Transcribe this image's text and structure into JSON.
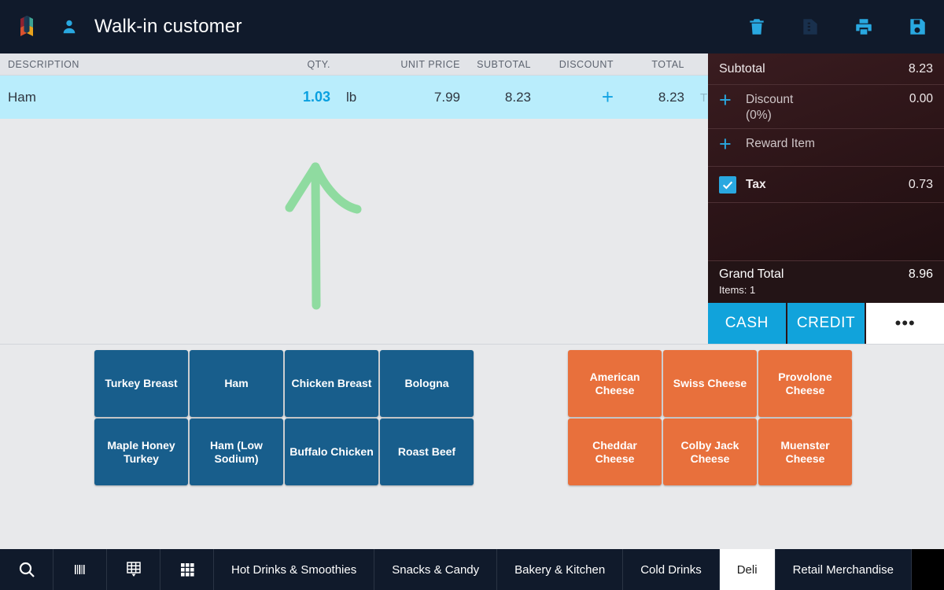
{
  "header": {
    "logo_icon": "leaf-logo-icon",
    "person_icon": "person-icon",
    "customer_name": "Walk-in customer",
    "actions": [
      {
        "name": "delete-order-button",
        "icon": "trash-icon",
        "enabled": true
      },
      {
        "name": "order-note-button",
        "icon": "note-icon",
        "enabled": false
      },
      {
        "name": "print-order-button",
        "icon": "printer-icon",
        "enabled": true
      },
      {
        "name": "save-order-button",
        "icon": "save-icon",
        "enabled": true
      }
    ]
  },
  "order_table": {
    "columns": {
      "description": "DESCRIPTION",
      "qty": "QTY.",
      "unit_price": "UNIT PRICE",
      "subtotal": "SUBTOTAL",
      "discount": "DISCOUNT",
      "total": "TOTAL"
    },
    "rows": [
      {
        "description": "Ham",
        "qty": "1.03",
        "unit": "lb",
        "unit_price": "7.99",
        "subtotal": "8.23",
        "discount_icon": "plus-icon",
        "total": "8.23",
        "tax_flag": "T",
        "selected": true
      }
    ]
  },
  "annotation": {
    "type": "hand-drawn-arrow",
    "points_to": "qty-value",
    "color": "#8fdba0"
  },
  "summary": {
    "subtotal_label": "Subtotal",
    "subtotal_value": "8.23",
    "discount_label": "Discount",
    "discount_percent": "(0%)",
    "discount_value": "0.00",
    "discount_add_icon": "plus-icon",
    "reward_label": "Reward Item",
    "reward_add_icon": "plus-icon",
    "tax_label": "Tax",
    "tax_value": "0.73",
    "tax_checked": true,
    "grand_total_label": "Grand Total",
    "grand_total_value": "8.96",
    "items_label": "Items: 1",
    "cash_label": "CASH",
    "credit_label": "CREDIT",
    "more_label": "•••"
  },
  "products": {
    "meats": [
      {
        "label": "Turkey Breast"
      },
      {
        "label": "Ham"
      },
      {
        "label": "Chicken Breast"
      },
      {
        "label": "Bologna"
      },
      {
        "label": "Maple Honey Turkey"
      },
      {
        "label": "Ham (Low Sodium)"
      },
      {
        "label": "Buffalo Chicken"
      },
      {
        "label": "Roast Beef"
      }
    ],
    "cheeses": [
      {
        "label": "American Cheese"
      },
      {
        "label": "Swiss Cheese"
      },
      {
        "label": "Provolone Cheese"
      },
      {
        "label": "Cheddar Cheese"
      },
      {
        "label": "Colby Jack Cheese"
      },
      {
        "label": "Muenster Cheese"
      }
    ],
    "meat_color": "#185e8c",
    "cheese_color": "#e8703c"
  },
  "bottom_bar": {
    "icons": [
      {
        "name": "search-icon"
      },
      {
        "name": "barcode-icon"
      },
      {
        "name": "grid-dropdown-icon"
      },
      {
        "name": "apps-grid-icon"
      }
    ],
    "tabs": [
      {
        "label": "Hot Drinks & Smoothies",
        "active": false
      },
      {
        "label": "Snacks & Candy",
        "active": false
      },
      {
        "label": "Bakery & Kitchen",
        "active": false
      },
      {
        "label": "Cold Drinks",
        "active": false
      },
      {
        "label": "Deli",
        "active": true
      },
      {
        "label": "Retail Merchandise",
        "active": false
      }
    ]
  },
  "colors": {
    "header_bg": "#101a2b",
    "accent_blue": "#29a8e0",
    "row_selected": "#b9edfc",
    "panel_bg": "#2b1417",
    "pay_blue": "#11a3db",
    "canvas": "#e8e9eb"
  }
}
